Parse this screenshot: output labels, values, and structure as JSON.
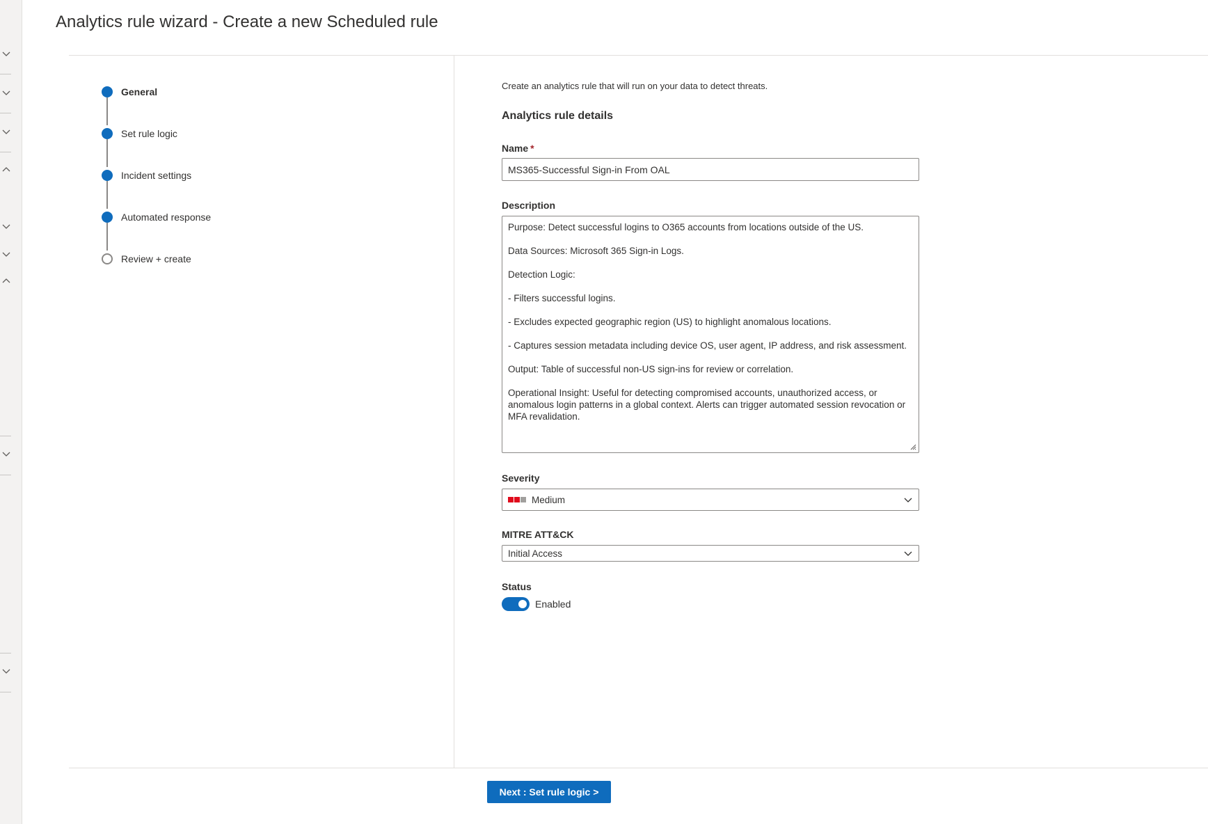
{
  "page": {
    "title": "Analytics rule wizard - Create a new Scheduled rule"
  },
  "steps": [
    {
      "label": "General",
      "state": "active"
    },
    {
      "label": "Set rule logic",
      "state": "complete"
    },
    {
      "label": "Incident settings",
      "state": "complete"
    },
    {
      "label": "Automated response",
      "state": "complete"
    },
    {
      "label": "Review + create",
      "state": "pending"
    }
  ],
  "form": {
    "intro": "Create an analytics rule that will run on your data to detect threats.",
    "section_title": "Analytics rule details",
    "name": {
      "label": "Name",
      "required_marker": "*",
      "value": "MS365-Successful Sign-in From OAL"
    },
    "description": {
      "label": "Description",
      "lines": [
        "Purpose: Detect successful logins to O365 accounts from locations outside of the US.",
        "Data Sources: Microsoft 365 Sign-in Logs.",
        "Detection Logic:",
        "- Filters successful logins.",
        "- Excludes expected geographic region (US) to highlight anomalous locations.",
        "- Captures session metadata including device OS, user agent, IP address, and risk assessment.",
        "Output: Table of successful non-US sign-ins for review or correlation.",
        "Operational Insight: Useful for detecting compromised accounts, unauthorized access, or anomalous login patterns in a global context. Alerts can trigger automated session revocation or MFA revalidation."
      ]
    },
    "severity": {
      "label": "Severity",
      "value": "Medium",
      "bar_colors": [
        "#e00b1c",
        "#e00b1c",
        "#a19f9d"
      ]
    },
    "mitre": {
      "label": "MITRE ATT&CK",
      "value": "Initial Access"
    },
    "status": {
      "label": "Status",
      "value": "Enabled",
      "enabled": true
    }
  },
  "footer": {
    "next_label": "Next : Set rule logic >"
  },
  "colors": {
    "accent": "#0f6cbd",
    "required": "#a4262c"
  }
}
